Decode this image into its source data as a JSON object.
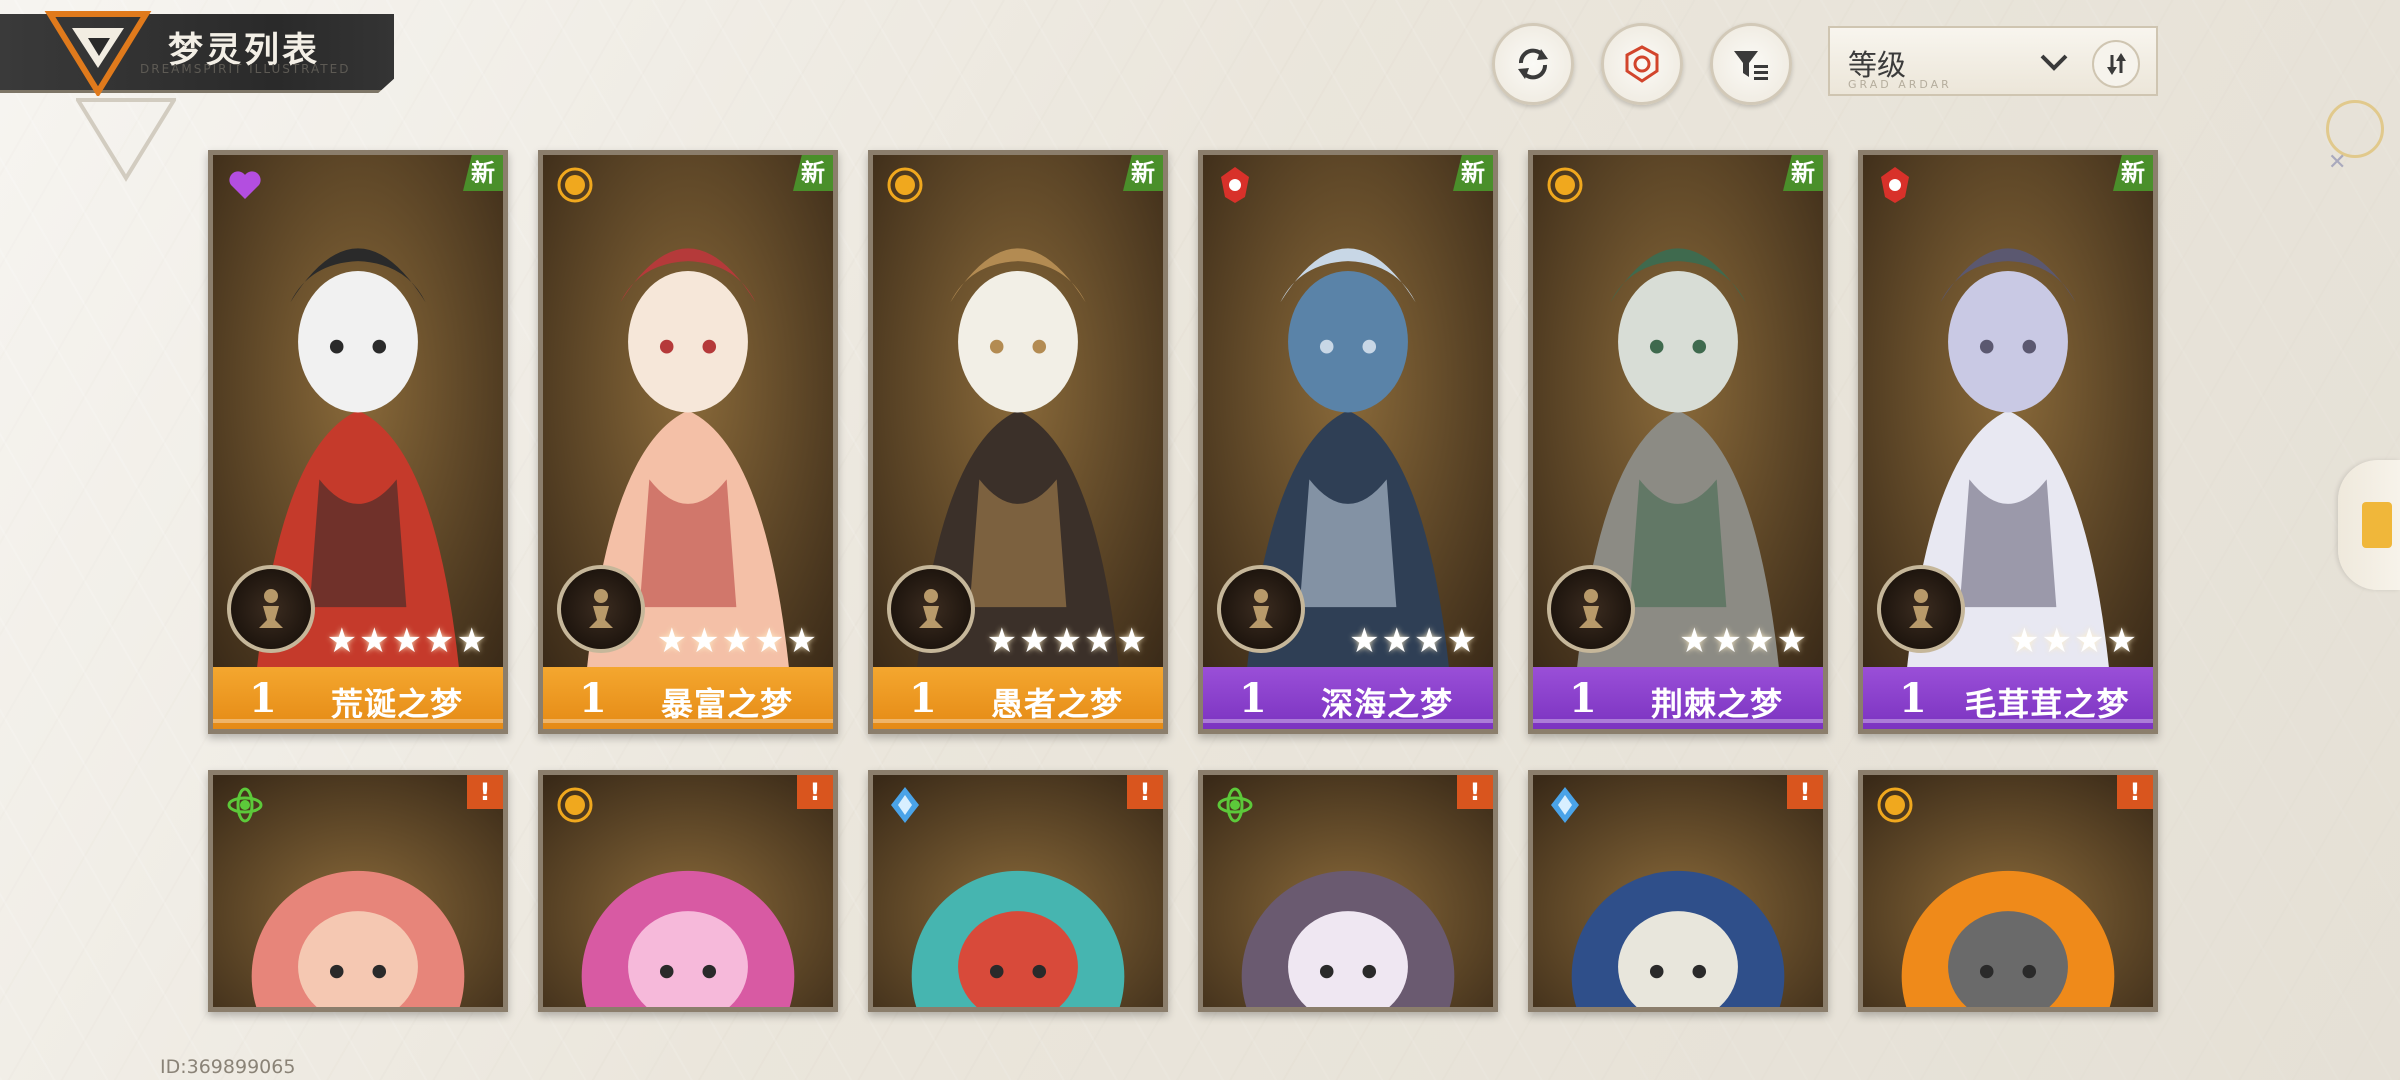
{
  "header": {
    "title": "梦灵列表",
    "title_sub": "DREAMSPIRIT ILLUSTRATED"
  },
  "toolbar": {
    "buttons": [
      {
        "name": "refresh-button",
        "icon": "refresh-icon"
      },
      {
        "name": "target-button",
        "icon": "target-icon"
      },
      {
        "name": "filter-button",
        "icon": "filter-icon"
      }
    ],
    "sort": {
      "label": "等级",
      "sub": "GRAD ARDAR",
      "order_icon": "sort-order-icon"
    }
  },
  "cards_top": [
    {
      "level": "1",
      "name": "荒诞之梦",
      "stars": "★★★★★",
      "tag": "新",
      "rarity": "gold",
      "element": "heart-element-icon",
      "element_color": "#b34ee0"
    },
    {
      "level": "1",
      "name": "暴富之梦",
      "stars": "★★★★★",
      "tag": "新",
      "rarity": "gold",
      "element": "sun-element-icon",
      "element_color": "#f0a81e"
    },
    {
      "level": "1",
      "name": "愚者之梦",
      "stars": "★★★★★",
      "tag": "新",
      "rarity": "gold",
      "element": "sun-element-icon",
      "element_color": "#f0a81e"
    },
    {
      "level": "1",
      "name": "深海之梦",
      "stars": "★★★★",
      "tag": "新",
      "rarity": "purple",
      "element": "fire-element-icon",
      "element_color": "#d8312a"
    },
    {
      "level": "1",
      "name": "荆棘之梦",
      "stars": "★★★★",
      "tag": "新",
      "rarity": "purple",
      "element": "sun-element-icon",
      "element_color": "#f0a81e"
    },
    {
      "level": "1",
      "name": "毛茸茸之梦",
      "stars": "★★★★",
      "tag": "新",
      "rarity": "purple",
      "element": "fire-element-icon",
      "element_color": "#d8312a"
    }
  ],
  "cards_bottom": [
    {
      "tag": "!",
      "element": "atom-element-icon",
      "element_color": "#5cc93a"
    },
    {
      "tag": "!",
      "element": "sun-element-icon",
      "element_color": "#f0a81e"
    },
    {
      "tag": "!",
      "element": "crystal-element-icon",
      "element_color": "#4aa3e8"
    },
    {
      "tag": "!",
      "element": "atom-element-icon",
      "element_color": "#5cc93a"
    },
    {
      "tag": "!",
      "element": "crystal-element-icon",
      "element_color": "#4aa3e8"
    },
    {
      "tag": "!",
      "element": "sun-element-icon",
      "element_color": "#f0a81e"
    }
  ],
  "footer": {
    "uid": "ID:369899065"
  },
  "colors": {
    "gold": "#f4a72f",
    "purple": "#9a4fd8",
    "new_tag": "#4a8f2a",
    "alert_tag": "#d9551e"
  }
}
